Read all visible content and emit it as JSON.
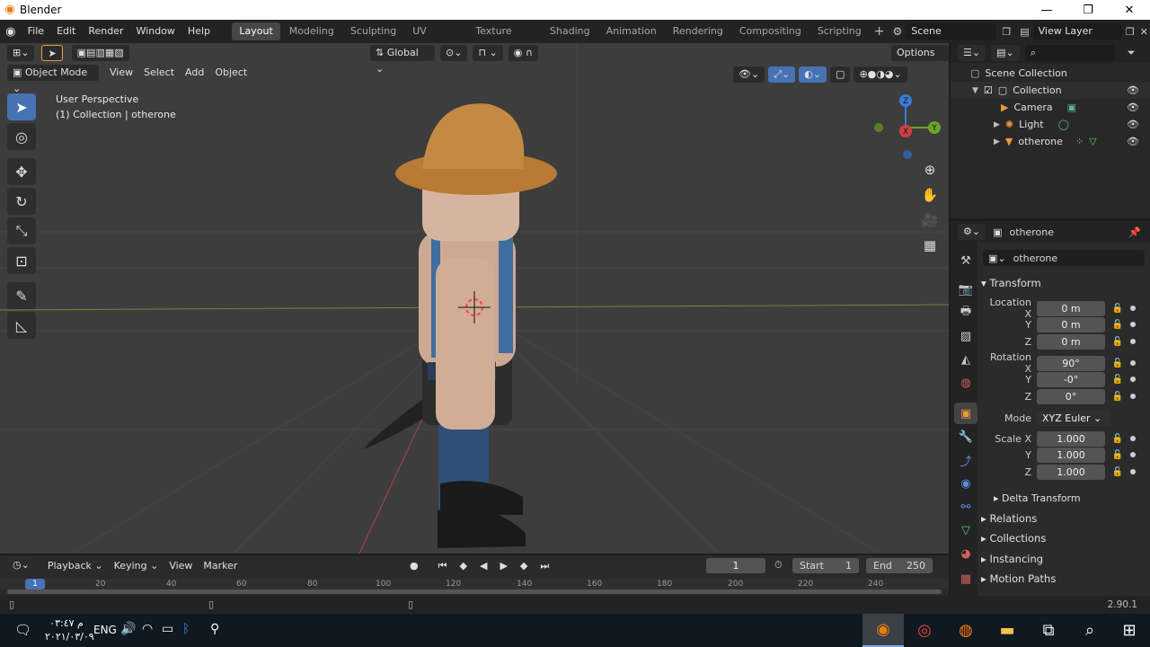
{
  "window": {
    "title": "Blender"
  },
  "menu": [
    "File",
    "Edit",
    "Render",
    "Window",
    "Help"
  ],
  "workspaces": [
    "Layout",
    "Modeling",
    "Sculpting",
    "UV Editing",
    "Texture Paint",
    "Shading",
    "Animation",
    "Rendering",
    "Compositing",
    "Scripting"
  ],
  "scene": {
    "name": "Scene",
    "view_layer": "View Layer"
  },
  "viewport": {
    "mode": "Object Mode",
    "menus": [
      "View",
      "Select",
      "Add",
      "Object"
    ],
    "orientation": "Global",
    "options_label": "Options",
    "perspective_label": "User Perspective",
    "collection_label": "(1) Collection | otherone",
    "gizmo_axes": {
      "x": "X",
      "y": "Y",
      "z": "Z"
    }
  },
  "outliner": {
    "scene_collection": "Scene Collection",
    "collection": "Collection",
    "items": [
      "Camera",
      "Light",
      "otherone"
    ]
  },
  "properties": {
    "object_name": "otherone",
    "datablock_name": "otherone",
    "panels": {
      "transform": "Transform",
      "delta_transform": "Delta Transform",
      "relations": "Relations",
      "collections": "Collections",
      "instancing": "Instancing",
      "motion_paths": "Motion Paths"
    },
    "location": {
      "label": "Location X",
      "x": "0 m",
      "y": "0 m",
      "z": "0 m"
    },
    "rotation": {
      "label": "Rotation X",
      "x": "90°",
      "y": "-0°",
      "z": "0°"
    },
    "mode": {
      "label": "Mode",
      "value": "XYZ Euler"
    },
    "scale": {
      "label": "Scale X",
      "x": "1.000",
      "y": "1.000",
      "z": "1.000"
    },
    "axis_labels": {
      "y": "Y",
      "z": "Z"
    }
  },
  "timeline": {
    "menus": [
      "Playback",
      "Keying",
      "View",
      "Marker"
    ],
    "current_frame": "1",
    "start_label": "Start",
    "start": "1",
    "end_label": "End",
    "end": "250",
    "ticks": [
      "1",
      "20",
      "40",
      "60",
      "80",
      "100",
      "120",
      "140",
      "160",
      "180",
      "200",
      "220",
      "240"
    ]
  },
  "status": {
    "version": "2.90.1"
  },
  "taskbar": {
    "time": "م ٠٣:٤٧",
    "date": "٢٠٢١/٠٣/٠٩",
    "lang": "ENG"
  }
}
